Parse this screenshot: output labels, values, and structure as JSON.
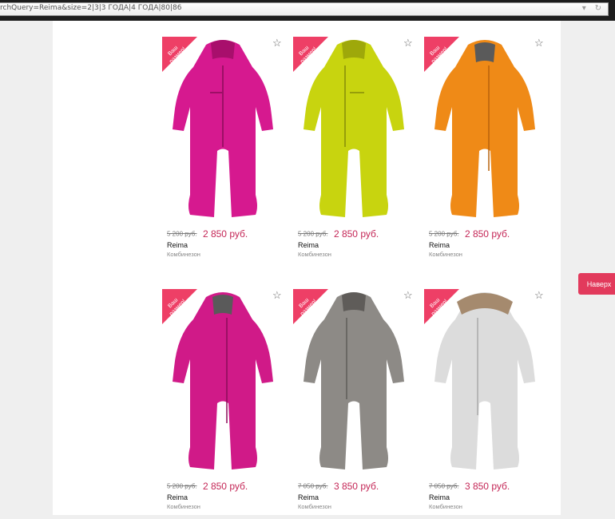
{
  "browser": {
    "url": "rchQuery=Reima&size=2|3|3 ГОДА|4 ГОДА|80|86"
  },
  "products": [
    {
      "badge": "Ваш размер!",
      "old_price": "5 200 руб.",
      "new_price": "2 850 руб.",
      "brand": "Reima",
      "type": "Комбинезон",
      "color": "#d6198f",
      "icon": "baby-overall"
    },
    {
      "badge": "Ваш размер!",
      "old_price": "5 200 руб.",
      "new_price": "2 850 руб.",
      "brand": "Reima",
      "type": "Комбинезон",
      "color": "#c8d40f",
      "icon": "baby-overall"
    },
    {
      "badge": "Ваш размер!",
      "old_price": "5 200 руб.",
      "new_price": "2 850 руб.",
      "brand": "Reima",
      "type": "Комбинезон",
      "color": "#ef8a17",
      "icon": "baby-overall"
    },
    {
      "badge": "Ваш размер!",
      "old_price": "5 200 руб.",
      "new_price": "2 850 руб.",
      "brand": "Reima",
      "type": "Комбинезон",
      "color": "#d01a88",
      "icon": "baby-overall"
    },
    {
      "badge": "Ваш размер!",
      "old_price": "7 050 руб.",
      "new_price": "3 850 руб.",
      "brand": "Reima",
      "type": "Комбинезон",
      "color": "#8d8a86",
      "icon": "baby-overall"
    },
    {
      "badge": "Ваш размер!",
      "old_price": "7 050 руб.",
      "new_price": "3 850 руб.",
      "brand": "Reima",
      "type": "Комбинезон",
      "color": "#dcdcdc",
      "icon": "baby-overall-fur-hood"
    }
  ],
  "scroll_top_button": {
    "label": "Наверх"
  },
  "colors": {
    "badge": "#ee3f66",
    "price": "#c42656",
    "scroll_button": "#e23a5c"
  }
}
